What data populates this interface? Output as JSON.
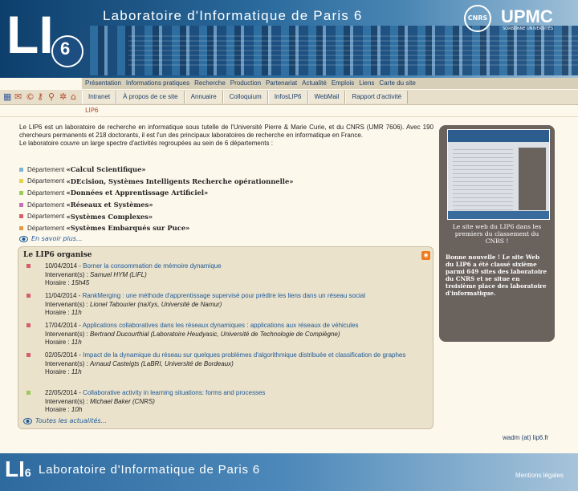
{
  "header": {
    "title": "Laboratoire d'Informatique de Paris 6",
    "logo_text": "LIP6",
    "cnrs_logo": "CNRS",
    "upmc_logo": "UPMC",
    "upmc_sub": "SORBONNE UNIVERSITÉS"
  },
  "submenu": [
    "Présentation",
    "Informations pratiques",
    "Recherche",
    "Production",
    "Partenariat",
    "Actualité",
    "Emplois",
    "Liens",
    "Carte du site"
  ],
  "toolbar": {
    "icons": [
      "flag-icon",
      "email-icon",
      "copyright-icon",
      "key-icon",
      "search-icon",
      "gear-icon",
      "home-icon"
    ],
    "tabs": [
      "Intranet",
      "À propos de ce site",
      "Annuaire",
      "Colloquium",
      "InfosLIP6",
      "WebMail",
      "Rapport d'activité"
    ]
  },
  "breadcrumb": "LIP6",
  "intro": {
    "p1": "Le LIP6 est un laboratoire de recherche en informatique sous tutelle de l'Université Pierre & Marie Curie, et du CNRS (UMR 7606). Avec 190 chercheurs permanents et 218 doctorants, il est l'un des principaux laboratoires de recherche en informatique en France.",
    "p2": "Le laboratoire couvre un large spectre d'activités regroupées au sein de 6 départements :"
  },
  "departments": [
    {
      "prefix": "Département",
      "name": "«Calcul Scientifique»",
      "color": "#7fb6d6"
    },
    {
      "prefix": "Département",
      "name": "«DEcision, Systèmes Intelligents Recherche opérationnelle»",
      "color": "#e6d24a"
    },
    {
      "prefix": "Département",
      "name": "«Données et Apprentissage Artificiel»",
      "color": "#9acb5a"
    },
    {
      "prefix": "Département",
      "name": "«Réseaux et Systèmes»",
      "color": "#c173b7"
    },
    {
      "prefix": "Département",
      "name": "«Systèmes Complexes»",
      "color": "#d75d6c"
    },
    {
      "prefix": "Département",
      "name": "«Systèmes Embarqués sur Puce»",
      "color": "#e59a4b"
    }
  ],
  "more_link": "En savoir plus...",
  "events": {
    "title": "Le LIP6 organise",
    "speaker_label": "Intervenant(s) :",
    "time_label": "Horaire :",
    "items": [
      {
        "date": "10/04/2014 -",
        "title": "Borner la consommation de mémoire dynamique",
        "speaker": "Samuel HYM (LIFL)",
        "time": "15h45",
        "color": "#d75d6c"
      },
      {
        "date": "11/04/2014 -",
        "title": "RankMerging : une méthode d'apprentissage supervisé pour prédire les liens dans un réseau social",
        "speaker": "Lionel Tabourier (naXys, Université de Namur)",
        "time": "11h",
        "color": "#d75d6c"
      },
      {
        "date": "17/04/2014 -",
        "title": "Applications collaboratives dans les réseaux dynamiques : applications aux réseaux de véhicules",
        "speaker": "Bertrand Ducourthial (Laboratoire Heudyasic, Université de Technologie de Compiègne)",
        "time": "11h",
        "color": "#d75d6c"
      },
      {
        "date": "02/05/2014 -",
        "title": "Impact de la dynamique du réseau sur quelques problèmes d'algorithmique distribuée et classification de graphes",
        "speaker": "Arnaud Casteigts (LaBRI, Université de Bordeaux)",
        "time": "11h",
        "color": "#d75d6c"
      },
      {
        "date": "22/05/2014 -",
        "title": "Collaborative activity in learning situations: forms and processes",
        "speaker": "Michael Baker (CNRS)",
        "time": "10h",
        "color": "#9acb5a"
      }
    ],
    "all_link": "Toutes les actualités..."
  },
  "right_panel": {
    "caption": "Le site web du LIP6 dans les premiers du classement du CNRS !",
    "text": "Bonne nouvelle ! Le site Web du LIP6 a été classé sixième parmi 649 sites des laboratoire du CNRS et se situe en troisième place des laboratoire d'informatique."
  },
  "contact": "wadm (at) lip6.fr",
  "footer": {
    "title": "Laboratoire d'Informatique de Paris 6",
    "legal": "Mentions légales",
    "logo_text": "LIP6"
  }
}
